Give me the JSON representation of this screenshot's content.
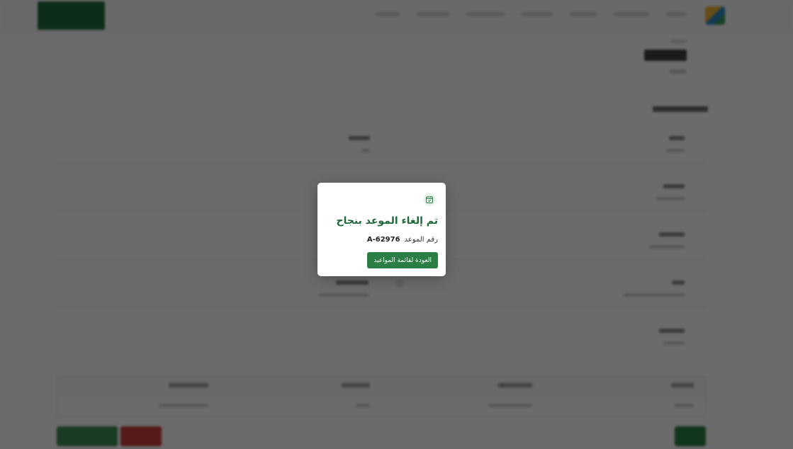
{
  "modal": {
    "icon": "calendar-check-icon",
    "title": "تم إلغاء الموعد بنجاح",
    "ref_label": "رقم الموعد",
    "ref_value": "A-62976",
    "button_label": "العودة لقائمة المواعيد"
  },
  "colors": {
    "primary": "#2a7e45",
    "title": "#1e6a3a",
    "danger": "#c0392b",
    "overlay": "rgba(0,0,0,0.58)"
  }
}
